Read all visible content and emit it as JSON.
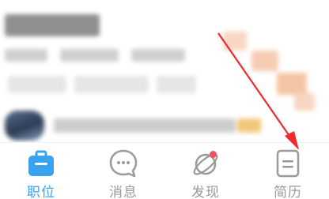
{
  "colors": {
    "accent": "#3aa3f0",
    "inactive": "#9a9a9a",
    "badge": "#f0525f",
    "arrow": "#f02a2a"
  },
  "tabbar": {
    "tabs": [
      {
        "label": "职位",
        "icon": "briefcase-icon",
        "active": true
      },
      {
        "label": "消息",
        "icon": "chat-bubble-icon",
        "active": false
      },
      {
        "label": "发现",
        "icon": "planet-icon",
        "active": false,
        "badge": true
      },
      {
        "label": "简历",
        "icon": "resume-icon",
        "active": false
      }
    ]
  }
}
